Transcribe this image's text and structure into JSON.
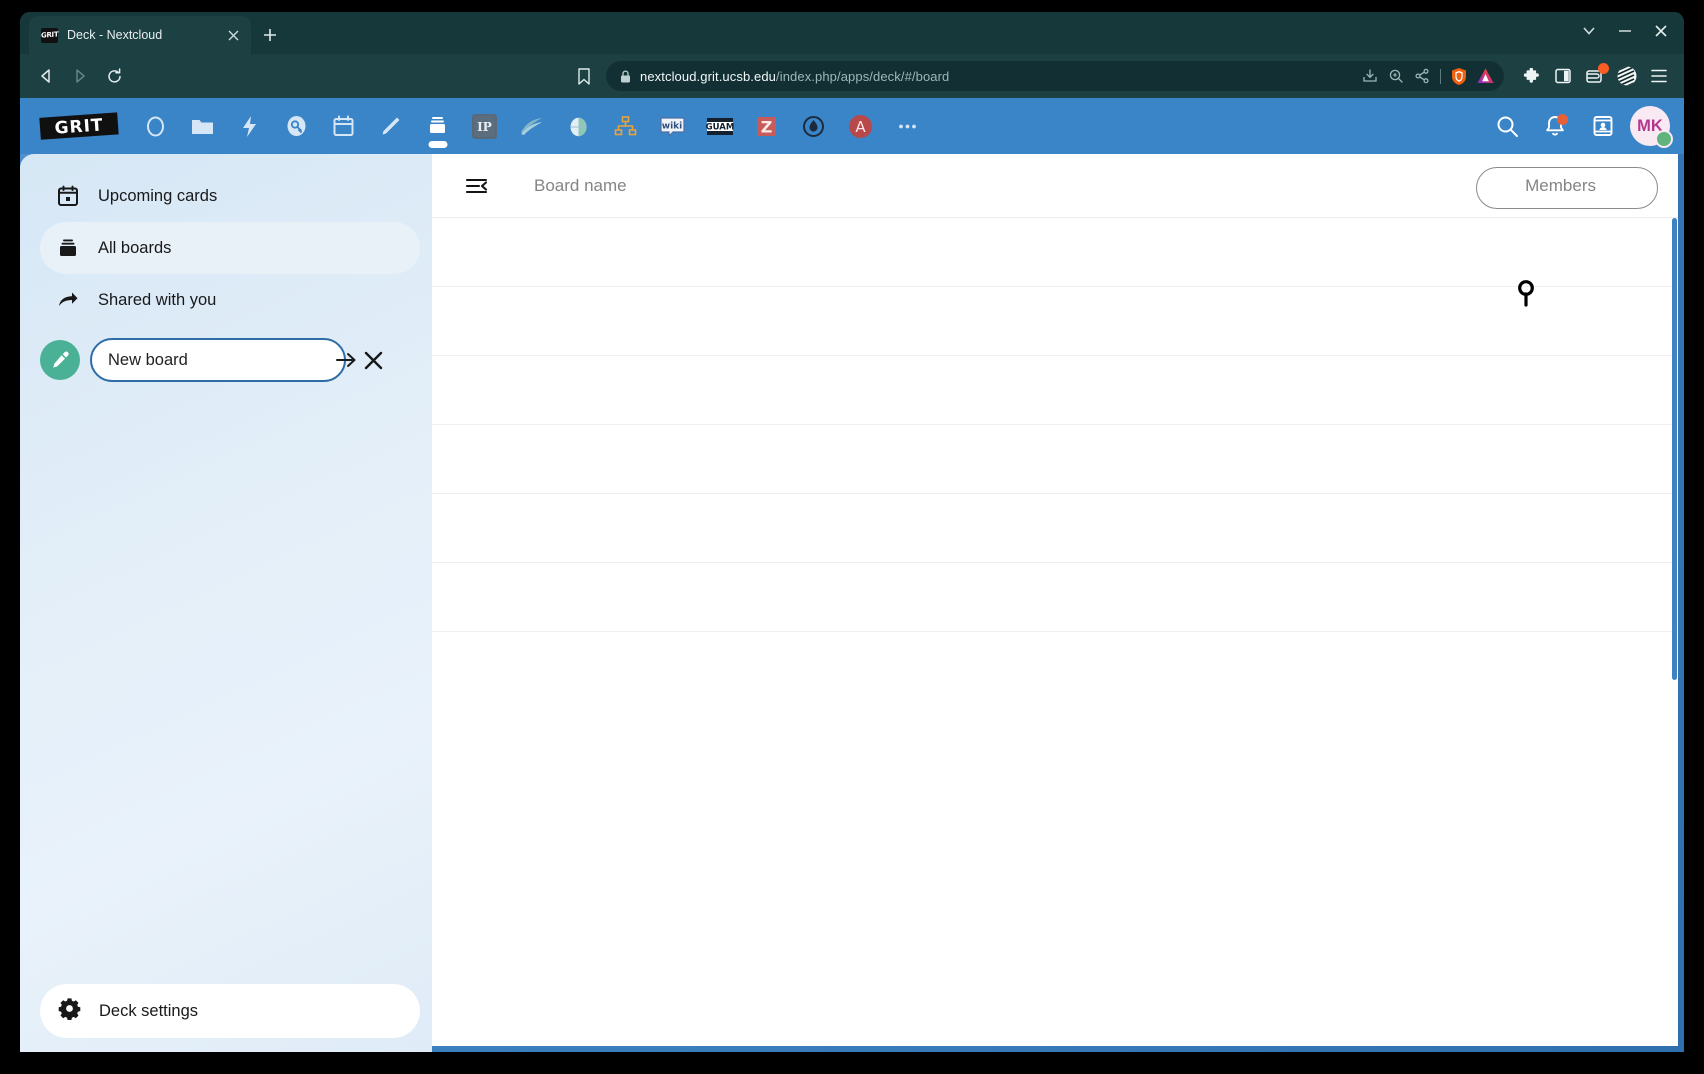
{
  "browser": {
    "tab": {
      "title": "Deck - Nextcloud",
      "favicon_label": "GRIT",
      "close_label": "×"
    },
    "new_tab_label": "+",
    "window_controls": {
      "tab_search_label": "⌄",
      "minimize_label": "—",
      "close_label": "✕"
    },
    "nav": {
      "back_label": "◁",
      "forward_label": "▷",
      "reload_label": "⟳"
    },
    "bookmark_label": "bookmark",
    "url": {
      "domain": "nextcloud.grit.ucsb.edu",
      "path": "/index.php/apps/deck/#/board",
      "full": "nextcloud.grit.ucsb.edu/index.php/apps/deck/#/board",
      "lock_label": "secure"
    },
    "url_actions": [
      "install-app",
      "zoom",
      "share"
    ],
    "toolbar_right": [
      "brave-shields",
      "brave-leo",
      "extensions",
      "sidebar-panel",
      "wallet",
      "brave-rewards",
      "app-menu"
    ],
    "theme_color": "#1d4043",
    "tabstrip_color": "#17383b"
  },
  "nextcloud": {
    "logo_text": "GRIT",
    "header_color": "#3a84c8",
    "apps": [
      {
        "name": "dashboard",
        "label": "Dashboard"
      },
      {
        "name": "files",
        "label": "Files"
      },
      {
        "name": "activity",
        "label": "Activity"
      },
      {
        "name": "passwords",
        "label": "Passwords"
      },
      {
        "name": "calendar",
        "label": "Calendar"
      },
      {
        "name": "notes",
        "label": "Notes"
      },
      {
        "name": "deck",
        "label": "Deck",
        "active": true
      },
      {
        "name": "ip",
        "label": "IP"
      },
      {
        "name": "waves",
        "label": "Waves"
      },
      {
        "name": "globe",
        "label": "Globe"
      },
      {
        "name": "orgchart",
        "label": "Org chart"
      },
      {
        "name": "wiki",
        "label": "wiki"
      },
      {
        "name": "guam",
        "label": "GUAM"
      },
      {
        "name": "z",
        "label": "Z"
      },
      {
        "name": "flame",
        "label": "Flame"
      },
      {
        "name": "a",
        "label": "A"
      },
      {
        "name": "more",
        "label": "..."
      }
    ],
    "header_actions": {
      "search_label": "Search",
      "notifications_label": "Notifications",
      "contacts_label": "Contacts"
    },
    "avatar": {
      "initials": "MK",
      "status": "online",
      "status_color": "#5fb47e",
      "bg_color": "#f9e9f2",
      "text_color": "#b4378e"
    }
  },
  "sidebar": {
    "items": [
      {
        "label": "Upcoming cards",
        "icon": "calendar-icon",
        "selected": false
      },
      {
        "label": "All boards",
        "icon": "boards-icon",
        "selected": true
      },
      {
        "label": "Shared with you",
        "icon": "share-arrow-icon",
        "selected": false
      }
    ],
    "new_board": {
      "value": "New board",
      "placeholder": "New board",
      "color": "#4ab196",
      "color_picker_label": "Pick board color",
      "submit_label": "Create board",
      "cancel_label": "Cancel"
    },
    "settings": {
      "label": "Deck settings",
      "icon": "gear-icon"
    }
  },
  "main": {
    "collapse_sidebar_label": "Collapse sidebar",
    "columns": {
      "board_name": "Board name",
      "members": "Members"
    },
    "rows": [
      {},
      {},
      {},
      {},
      {},
      {}
    ]
  }
}
